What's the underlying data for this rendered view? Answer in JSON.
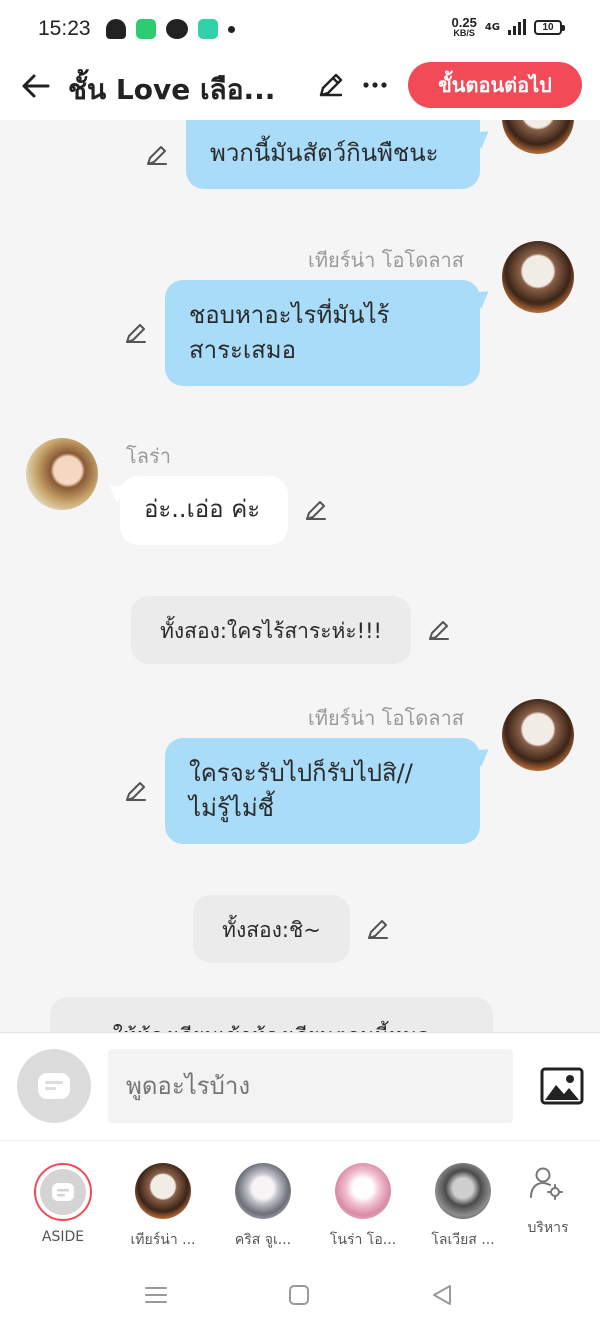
{
  "status_bar": {
    "time": "15:23",
    "net_speed": "0.25",
    "net_unit": "KB/S",
    "network": "4G",
    "battery": "10"
  },
  "header": {
    "title": "ชั้น Love เลือ...",
    "next_button": "ขั้นตอนต่อไป"
  },
  "messages": [
    {
      "type": "mine",
      "sender": "",
      "text": "พวกนี้มันสัตว์กินพืชนะ"
    },
    {
      "type": "mine",
      "sender": "เทียร์น่า โอโดลาส",
      "lines": [
        "ชอบหาอะไรที่มันไร้",
        "สาระเสมอ"
      ]
    },
    {
      "type": "theirs",
      "sender": "โลร่า",
      "text": "อ่ะ..เอ่อ ค่ะ"
    },
    {
      "type": "narration",
      "text": "ทั้งสอง:ใครไร้สาระห่ะ!!!"
    },
    {
      "type": "mine",
      "sender": "เทียร์น่า โอโดลาส",
      "lines": [
        "ใครจะรับไปก็รับไปสิ//",
        "ไม่รู้ไม่ชี้"
      ]
    },
    {
      "type": "narration",
      "text": "ทั้งสอง:ชิ~"
    },
    {
      "type": "narration",
      "text": "ให้ห้องเรียนเข้าห้องเรียนตอนนี้หมด"
    }
  ],
  "input": {
    "placeholder": "พูดอะไรบ้าง"
  },
  "characters": [
    {
      "name": "ASIDE"
    },
    {
      "name": "เทียร์น่า ..."
    },
    {
      "name": "คริส จูเ..."
    },
    {
      "name": "โนร่า โอ..."
    },
    {
      "name": "โลเวียส ..."
    },
    {
      "name": "บริหาร"
    }
  ],
  "colors": {
    "accent": "#f24a57",
    "bubble_mine": "#a8dcf9",
    "bubble_theirs": "#ffffff",
    "narration": "#ebebeb",
    "background": "#f5f5f5"
  },
  "icons": [
    "back-arrow-icon",
    "pencil-icon",
    "more-dots-icon",
    "image-icon",
    "chat-icon",
    "manage-user-icon",
    "menu-icon",
    "home-square-icon",
    "back-triangle-icon"
  ]
}
